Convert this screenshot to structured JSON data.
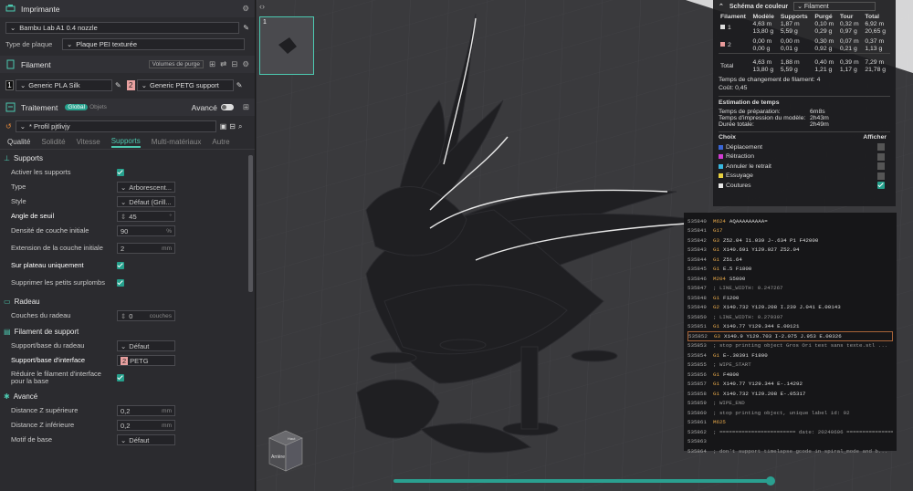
{
  "printer": {
    "header": "Imprimante",
    "name": "Bambu Lab A1 0.4 nozzle",
    "plate_label": "Type de plaque",
    "plate_value": "Plaque PEI texturée"
  },
  "filament": {
    "header": "Filament",
    "volumes_btn": "Volumes de purge",
    "slot1_num": "1",
    "slot1": "Generic PLA Silk",
    "slot2_num": "2",
    "slot2": "Generic PETG support"
  },
  "process": {
    "header": "Traitement",
    "global": "Global",
    "objects": "Objets",
    "advanced": "Avancé",
    "profile": "* Profil pjtlivjy"
  },
  "tabs": [
    "Qualité",
    "Solidité",
    "Vitesse",
    "Supports",
    "Multi-matériaux",
    "Autre"
  ],
  "supports": {
    "group": "Supports",
    "enable": "Activer les supports",
    "type_label": "Type",
    "type_value": "Arborescent...",
    "style_label": "Style",
    "style_value": "Défaut (Grill...",
    "angle_label": "Angle de seuil",
    "angle_value": "45",
    "angle_unit": "°",
    "density_label": "Densité de couche initiale",
    "density_value": "90",
    "density_unit": "%",
    "ext_label": "Extension de la couche initiale",
    "ext_value": "2",
    "ext_unit": "mm",
    "plate_only": "Sur plateau uniquement",
    "remove_small": "Supprimer les petits surplombs"
  },
  "raft": {
    "group": "Radeau",
    "layers_label": "Couches du radeau",
    "layers_value": "0",
    "layers_unit": "couches"
  },
  "support_filament": {
    "group": "Filament de support",
    "base_label": "Support/base du radeau",
    "base_value": "Défaut",
    "iface_label": "Support/base d'interface",
    "iface_num": "2",
    "iface_value": "PETG",
    "reduce_label": "Réduire le filament d'interface pour la base"
  },
  "advanced": {
    "group": "Avancé",
    "z_top_label": "Distance Z supérieure",
    "z_top_value": "0,2",
    "z_bot_label": "Distance Z inférieure",
    "z_bot_value": "0,2",
    "unit": "mm",
    "pattern_label": "Motif de base",
    "pattern_value": "Défaut"
  },
  "legend": {
    "title": "Schéma de couleur",
    "mode": "Filament",
    "headers": [
      "Filament",
      "Modèle",
      "Supports",
      "Purgé",
      "Tour",
      "Total"
    ],
    "rows": [
      {
        "id": "1",
        "color": "#dddddd",
        "l1": [
          "4,63 m",
          "1,87 m",
          "0,10 m",
          "0,32 m",
          "6,92 m"
        ],
        "l2": [
          "13,80 g",
          "5,59 g",
          "0,29 g",
          "0,97 g",
          "20,65 g"
        ]
      },
      {
        "id": "2",
        "color": "#e89a9a",
        "l1": [
          "0,00 m",
          "0,00 m",
          "0,30 m",
          "0,07 m",
          "0,37 m"
        ],
        "l2": [
          "0,00 g",
          "0,01 g",
          "0,92 g",
          "0,21 g",
          "1,13 g"
        ]
      }
    ],
    "total_label": "Total",
    "total_l1": [
      "4,63 m",
      "1,88 m",
      "0,40 m",
      "0,39 m",
      "7,29 m"
    ],
    "total_l2": [
      "13,80 g",
      "5,59 g",
      "1,21 g",
      "1,17 g",
      "21,78 g"
    ],
    "change_time": "Temps de changement de filament:  4",
    "cost": "Coût:  0,45",
    "estimate_title": "Estimation de temps",
    "prep_label": "Temps de préparation:",
    "prep_value": "6m8s",
    "model_label": "Temps d'impression du modèle:",
    "model_value": "2h43m",
    "total_time_label": "Durée totale:",
    "total_time_value": "2h49m",
    "choice_label": "Choix",
    "show_label": "Afficher",
    "choices": [
      {
        "name": "Déplacement",
        "color": "#3a66d6"
      },
      {
        "name": "Rétraction",
        "color": "#d33cd3"
      },
      {
        "name": "Annuler le retrait",
        "color": "#38b8e0"
      },
      {
        "name": "Essuyage",
        "color": "#e8d040"
      },
      {
        "name": "Coutures",
        "color": "#e8e8e8"
      }
    ]
  },
  "gcode": [
    {
      "n": "535840",
      "c": "M624",
      "a": "AQAAAAAAAAA="
    },
    {
      "n": "535841",
      "c": "G17",
      "a": ""
    },
    {
      "n": "535842",
      "c": "G3",
      "a": "Z52.04 I1.039 J-.634 P1 F42000"
    },
    {
      "n": "535843",
      "c": "G1",
      "a": "X140.691 Y129.027 Z52.04"
    },
    {
      "n": "535844",
      "c": "G1",
      "a": "Z51.64"
    },
    {
      "n": "535845",
      "c": "G1",
      "a": "E.5 F1800"
    },
    {
      "n": "535846",
      "c": "M204",
      "a": "S5000"
    },
    {
      "n": "535847",
      "c": "",
      "a": "; LINE_WIDTH: 0.247267"
    },
    {
      "n": "535848",
      "c": "G1",
      "a": "F1200"
    },
    {
      "n": "535849",
      "c": "G2",
      "a": "X140.732 Y129.208 I.239 J.041 E.00143"
    },
    {
      "n": "535850",
      "c": "",
      "a": "; LINE_WIDTH: 0.279307"
    },
    {
      "n": "535851",
      "c": "G1",
      "a": "X140.77 Y129.344 E.00121"
    },
    {
      "n": "535852",
      "c": "G3",
      "a": "X140.9 Y129.703 I-2.075 J.953 E.00326"
    },
    {
      "n": "535853",
      "c": "",
      "a": "; stop printing object Gros Ori test sans texte.stl ..."
    },
    {
      "n": "535854",
      "c": "G1",
      "a": "E-.30391 F1800"
    },
    {
      "n": "535855",
      "c": "",
      "a": "; WIPE_START"
    },
    {
      "n": "535856",
      "c": "G1",
      "a": "F4800"
    },
    {
      "n": "535857",
      "c": "G1",
      "a": "X140.77 Y129.344 E-.14292"
    },
    {
      "n": "535858",
      "c": "G1",
      "a": "X140.732 Y129.208 E-.05317"
    },
    {
      "n": "535859",
      "c": "",
      "a": "; WIPE_END"
    },
    {
      "n": "535860",
      "c": "",
      "a": "; stop printing object, unique label id: 92"
    },
    {
      "n": "535861",
      "c": "M625",
      "a": ""
    },
    {
      "n": "535862",
      "c": "",
      "a": "; ======================== date: 20240606 ================..."
    },
    {
      "n": "535863",
      "c": "",
      "a": ""
    },
    {
      "n": "535864",
      "c": "",
      "a": "; don't support timelapse gcode in spiral_mode and b..."
    }
  ],
  "gcode_selected": "535852",
  "viewport": {
    "thumb_num": "1",
    "cube_top": "Haut",
    "cube_back": "Arrière"
  }
}
